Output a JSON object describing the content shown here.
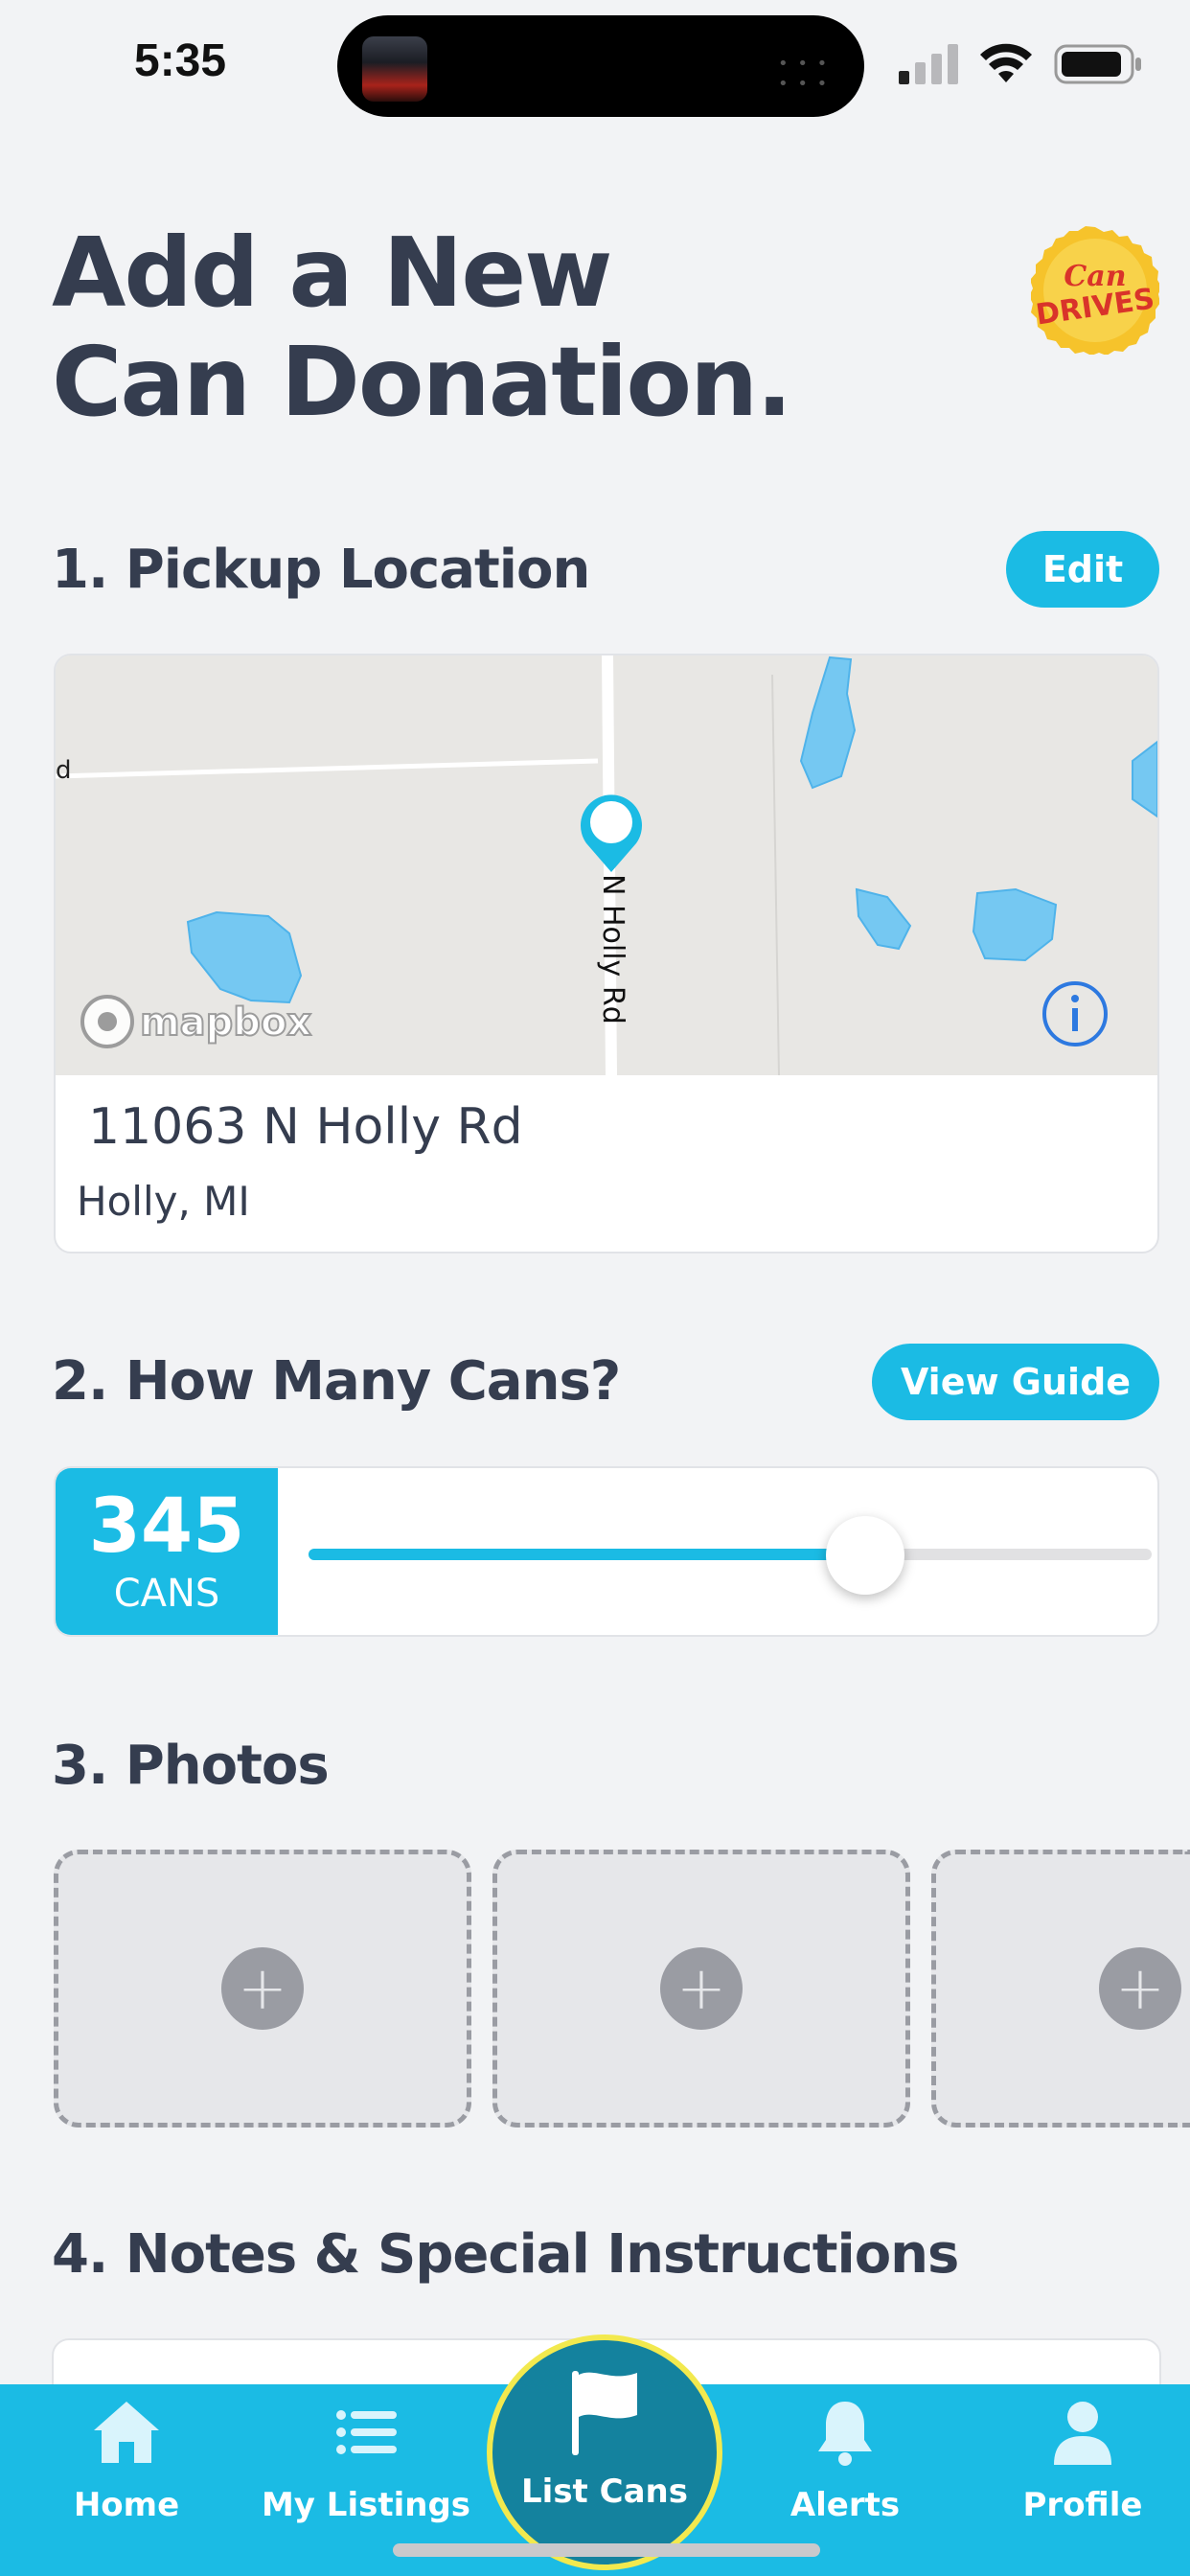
{
  "status_bar": {
    "time": "5:35"
  },
  "header": {
    "title_line1": "Add a New",
    "title_line2": "Can Donation.",
    "logo_line1": "Can",
    "logo_line2": "DRIVES"
  },
  "location": {
    "heading": "1. Pickup Location",
    "edit_label": "Edit",
    "map_road_label": "N Holly Rd",
    "map_left_label": "d",
    "map_attribution": "mapbox",
    "address_line": "11063 N Holly Rd",
    "city_line": "Holly, MI"
  },
  "cans": {
    "heading": "2. How Many Cans?",
    "guide_label": "View Guide",
    "count": "345",
    "unit": "CANS",
    "slider_fraction": 0.66
  },
  "photos": {
    "heading": "3. Photos",
    "add_symbol": "+"
  },
  "notes": {
    "heading": "4. Notes & Special Instructions"
  },
  "tabbar": {
    "home": "Home",
    "my_listings": "My Listings",
    "list_cans": "List Cans",
    "alerts": "Alerts",
    "profile": "Profile"
  },
  "colors": {
    "accent": "#1bbbe4",
    "text": "#353d4f",
    "center_tab": "#14829e",
    "center_ring": "#f2e94e"
  }
}
